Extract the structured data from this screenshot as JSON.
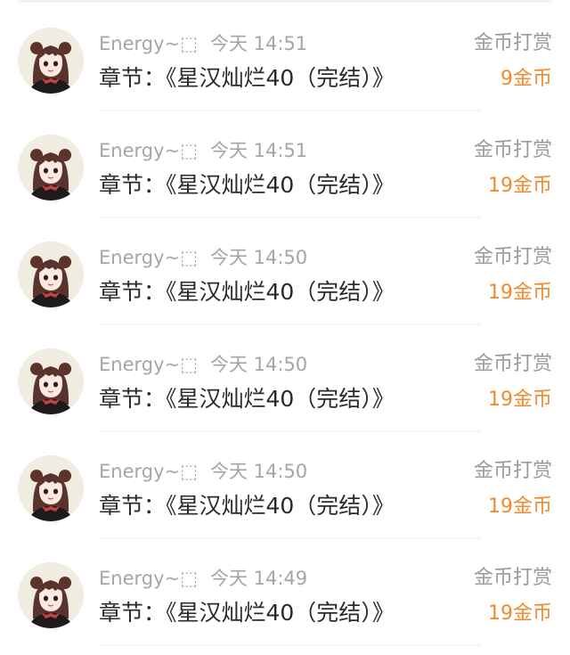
{
  "items": [
    {
      "user": "Energy~⬚",
      "time": "今天 14:51",
      "chapter": "章节：《星汉灿烂40（完结）》",
      "reward_type": "金币打赏",
      "reward_amount": "9金币"
    },
    {
      "user": "Energy~⬚",
      "time": "今天 14:51",
      "chapter": "章节：《星汉灿烂40（完结）》",
      "reward_type": "金币打赏",
      "reward_amount": "19金币"
    },
    {
      "user": "Energy~⬚",
      "time": "今天 14:50",
      "chapter": "章节：《星汉灿烂40（完结）》",
      "reward_type": "金币打赏",
      "reward_amount": "19金币"
    },
    {
      "user": "Energy~⬚",
      "time": "今天 14:50",
      "chapter": "章节：《星汉灿烂40（完结）》",
      "reward_type": "金币打赏",
      "reward_amount": "19金币"
    },
    {
      "user": "Energy~⬚",
      "time": "今天 14:50",
      "chapter": "章节：《星汉灿烂40（完结）》",
      "reward_type": "金币打赏",
      "reward_amount": "19金币"
    },
    {
      "user": "Energy~⬚",
      "time": "今天 14:49",
      "chapter": "章节：《星汉灿烂40（完结）》",
      "reward_type": "金币打赏",
      "reward_amount": "19金币"
    }
  ],
  "colors": {
    "reward_amount": "#f08a2c",
    "meta_text": "#a5a5a5",
    "reward_type_text": "#9a9a9a",
    "main_text": "#2a2a2a"
  },
  "icons": {
    "avatar": "anime-girl-avatar-icon"
  }
}
